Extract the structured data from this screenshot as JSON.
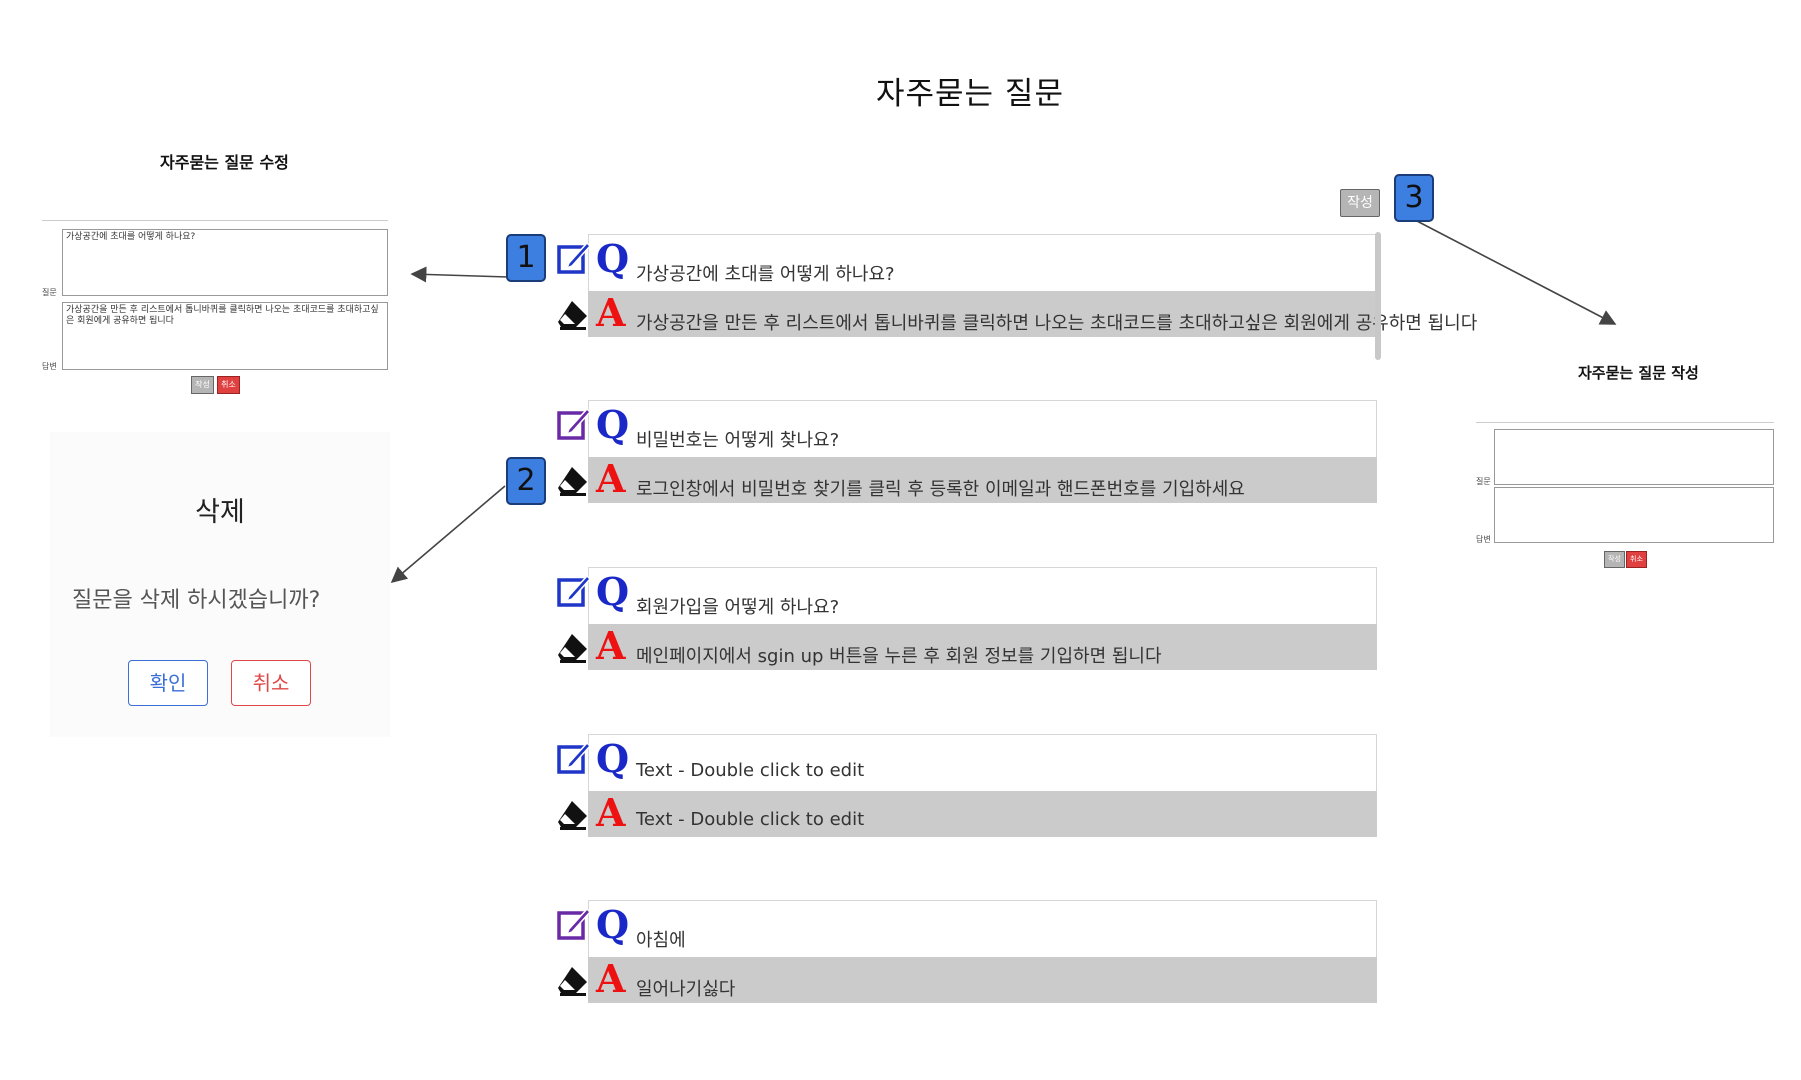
{
  "page": {
    "title": "자주묻는 질문"
  },
  "toolbar": {
    "write_button": "작성"
  },
  "callouts": [
    "1",
    "2",
    "3"
  ],
  "faqs": [
    {
      "q_mark": "Q",
      "a_mark": "A",
      "question": "가상공간에 초대를 어떻게 하나요?",
      "answer": "가상공간을 만든 후 리스트에서 톱니바퀴를 클릭하면 나오는 초대코드를 초대하고싶은 회원에게 공유하면 됩니다"
    },
    {
      "q_mark": "Q",
      "a_mark": "A",
      "question": "비밀번호는 어떻게 찾나요?",
      "answer": "로그인창에서 비밀번호 찾기를 클릭 후 등록한 이메일과 핸드폰번호를 기입하세요"
    },
    {
      "q_mark": "Q",
      "a_mark": "A",
      "question": "회원가입을 어떻게 하나요?",
      "answer": "메인페이지에서 sgin up 버튼을 누른 후 회원 정보를 기입하면 됩니다"
    },
    {
      "q_mark": "Q",
      "a_mark": "A",
      "question": "Text - Double click to edit",
      "answer": "Text - Double click to edit"
    },
    {
      "q_mark": "Q",
      "a_mark": "A",
      "question": "아침에",
      "answer": "일어나기싫다"
    }
  ],
  "edit_panel": {
    "title": "자주묻는 질문 수정",
    "question_label": "질문",
    "answer_label": "답변",
    "question_value": "가상공간에 초대를 어떻게 하나요?",
    "answer_value": "가상공간을 만든 후 리스트에서 톱니바퀴를 클릭하면 나오는 초대코드를 초대하고싶은 회원에게 공유하면 됩니다",
    "submit": "작성",
    "cancel": "취소"
  },
  "delete_dialog": {
    "title": "삭제",
    "message": "질문을 삭제 하시겠습니까?",
    "confirm": "확인",
    "cancel": "취소"
  },
  "create_panel": {
    "title": "자주묻는 질문 작성",
    "question_label": "질문",
    "answer_label": "답변",
    "submit": "작성",
    "cancel": "취소"
  }
}
